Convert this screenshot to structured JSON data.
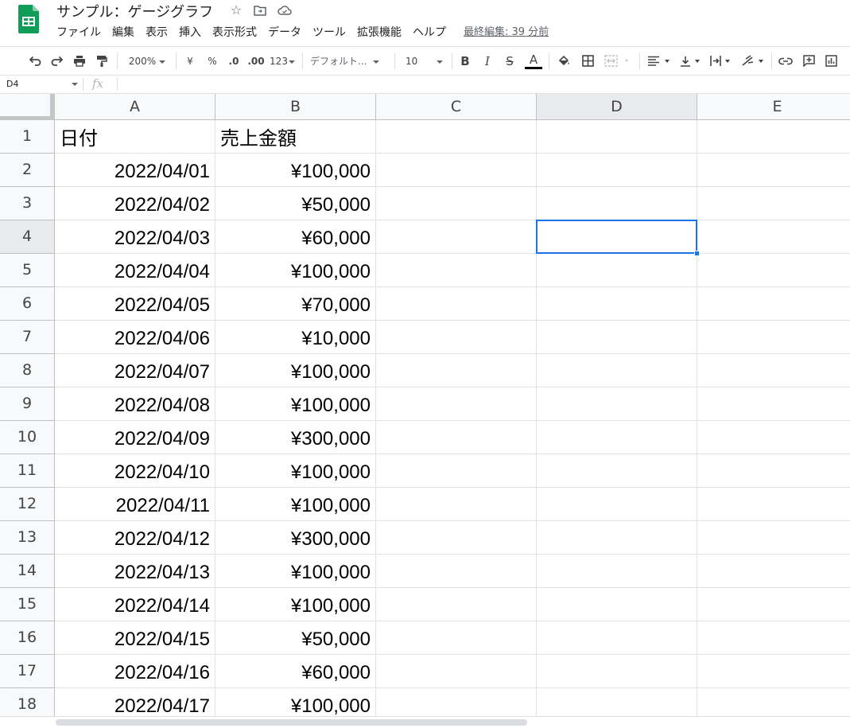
{
  "doc": {
    "title": "サンプル：ゲージグラフ",
    "last_edit": "最終編集: 39 分前"
  },
  "menu": [
    "ファイル",
    "編集",
    "表示",
    "挿入",
    "表示形式",
    "データ",
    "ツール",
    "拡張機能",
    "ヘルプ"
  ],
  "toolbar": {
    "zoom": "200%",
    "currency": "¥",
    "percent": "%",
    "decrease_decimal": ".0",
    "increase_decimal": ".00",
    "number_format": "123",
    "font": "デフォルト...",
    "font_size": "10",
    "bold": "B",
    "italic": "I",
    "strike": "S",
    "text_color": "A"
  },
  "formula_bar": {
    "name_box": "D4",
    "fx": "fx",
    "value": ""
  },
  "columns": [
    "A",
    "B",
    "C",
    "D",
    "E"
  ],
  "selected": {
    "cell": "D4",
    "column": "D",
    "row": 4
  },
  "rows": [
    {
      "num": "1",
      "a": "日付",
      "b": "売上金額"
    },
    {
      "num": "2",
      "a": "2022/04/01",
      "b": "¥100,000"
    },
    {
      "num": "3",
      "a": "2022/04/02",
      "b": "¥50,000"
    },
    {
      "num": "4",
      "a": "2022/04/03",
      "b": "¥60,000"
    },
    {
      "num": "5",
      "a": "2022/04/04",
      "b": "¥100,000"
    },
    {
      "num": "6",
      "a": "2022/04/05",
      "b": "¥70,000"
    },
    {
      "num": "7",
      "a": "2022/04/06",
      "b": "¥10,000"
    },
    {
      "num": "8",
      "a": "2022/04/07",
      "b": "¥100,000"
    },
    {
      "num": "9",
      "a": "2022/04/08",
      "b": "¥100,000"
    },
    {
      "num": "10",
      "a": "2022/04/09",
      "b": "¥300,000"
    },
    {
      "num": "11",
      "a": "2022/04/10",
      "b": "¥100,000"
    },
    {
      "num": "12",
      "a": "2022/04/11",
      "b": "¥100,000"
    },
    {
      "num": "13",
      "a": "2022/04/12",
      "b": "¥300,000"
    },
    {
      "num": "14",
      "a": "2022/04/13",
      "b": "¥100,000"
    },
    {
      "num": "15",
      "a": "2022/04/14",
      "b": "¥100,000"
    },
    {
      "num": "16",
      "a": "2022/04/15",
      "b": "¥50,000"
    },
    {
      "num": "17",
      "a": "2022/04/16",
      "b": "¥60,000"
    },
    {
      "num": "18",
      "a": "2022/04/17",
      "b": "¥100,000"
    }
  ],
  "colors": {
    "accent": "#1a73e8",
    "sheets_green": "#0f9d58",
    "header_bg": "#f8f9fa",
    "header_selected_bg": "#e8eaed"
  }
}
